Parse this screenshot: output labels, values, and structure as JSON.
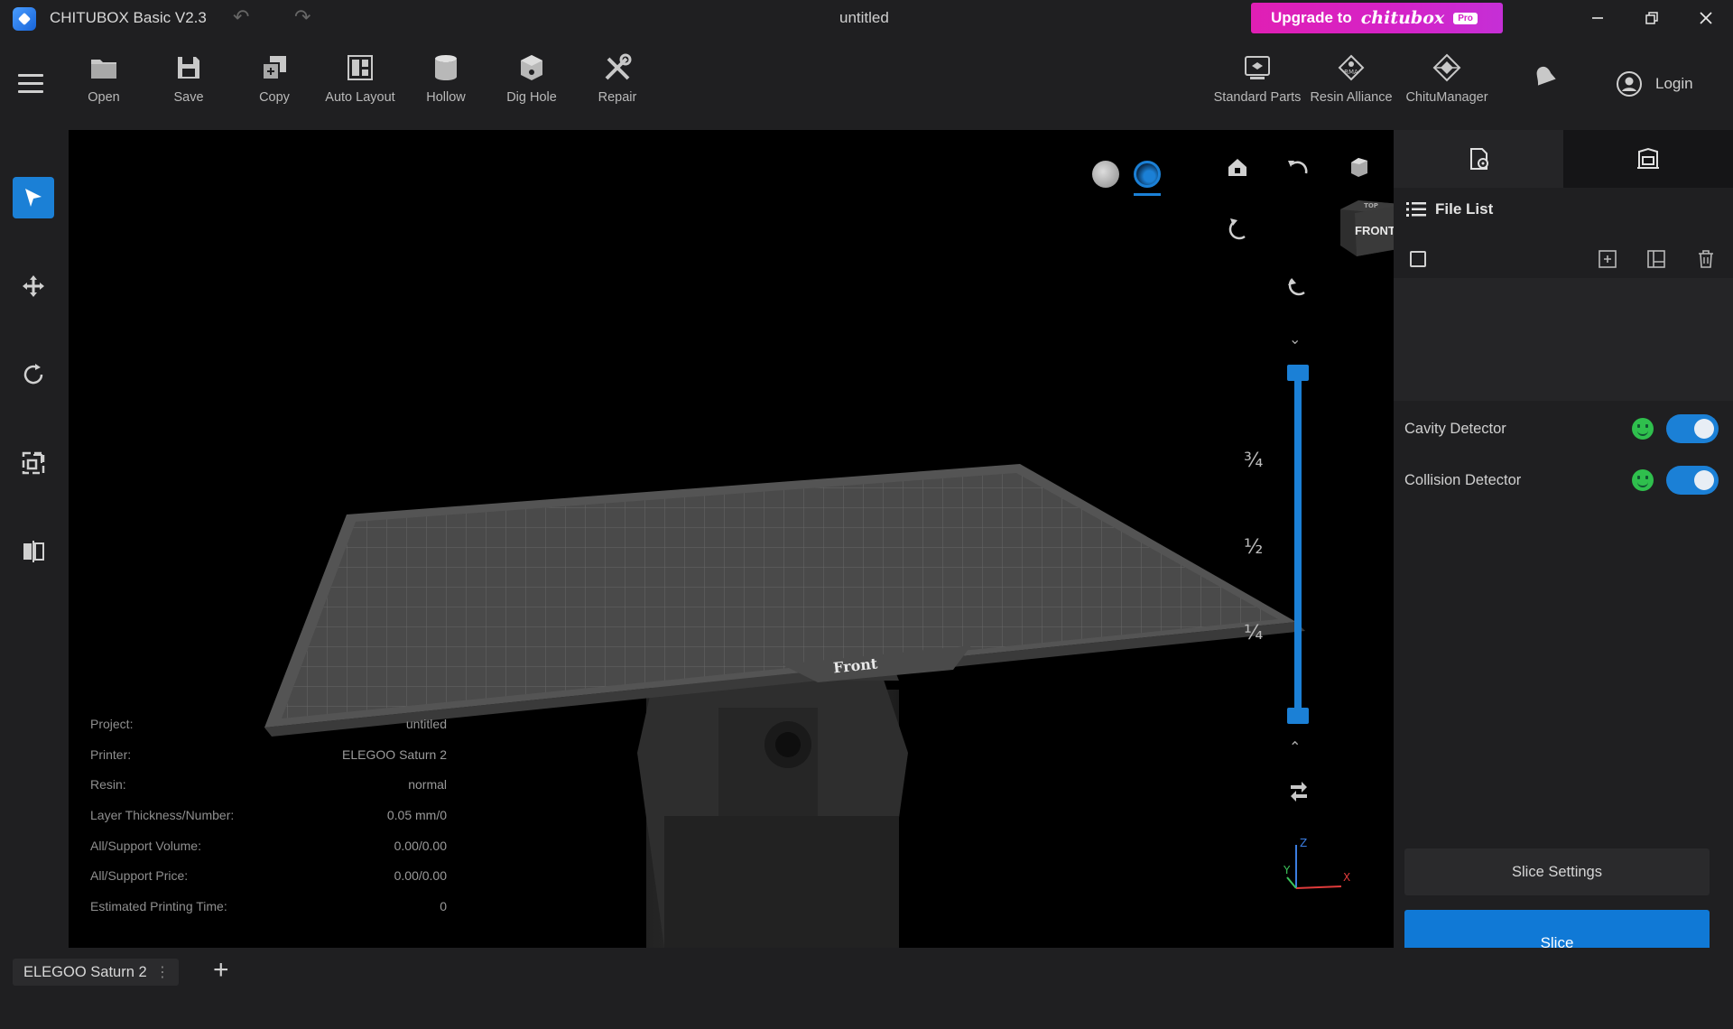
{
  "titlebar": {
    "app_title": "CHITUBOX Basic V2.3",
    "document_title": "untitled",
    "upgrade_label": "Upgrade to",
    "upgrade_brand": "chitubox",
    "upgrade_badge": "Pro"
  },
  "toolbar": {
    "tools": [
      {
        "label": "Open",
        "icon": "folder-icon"
      },
      {
        "label": "Save",
        "icon": "save-icon"
      },
      {
        "label": "Copy",
        "icon": "copy-icon"
      },
      {
        "label": "Auto Layout",
        "icon": "auto-layout-icon"
      },
      {
        "label": "Hollow",
        "icon": "hollow-icon"
      },
      {
        "label": "Dig Hole",
        "icon": "dig-hole-icon"
      },
      {
        "label": "Repair",
        "icon": "repair-icon"
      }
    ],
    "right_tools": [
      {
        "label": "Standard Parts",
        "icon": "standard-parts-icon"
      },
      {
        "label": "Resin Alliance",
        "icon": "resin-alliance-icon"
      },
      {
        "label": "ChituManager",
        "icon": "chitumanager-icon"
      }
    ],
    "login_label": "Login"
  },
  "viewport": {
    "plate_label": "Front",
    "view_cube_label": "FRONT",
    "view_cube_top_label": "TOP",
    "z_fractions": [
      "¾",
      "½",
      "¼"
    ],
    "axis_labels": {
      "z": "Z",
      "y": "Y",
      "x": "X"
    },
    "info": [
      {
        "label": "Project:",
        "value": "untitled"
      },
      {
        "label": "Printer:",
        "value": "ELEGOO Saturn 2"
      },
      {
        "label": "Resin:",
        "value": "normal"
      },
      {
        "label": "Layer Thickness/Number:",
        "value": "0.05 mm/0"
      },
      {
        "label": "All/Support Volume:",
        "value": "0.00/0.00"
      },
      {
        "label": "All/Support Price:",
        "value": "0.00/0.00"
      },
      {
        "label": "Estimated Printing Time:",
        "value": "0"
      }
    ]
  },
  "right_panel": {
    "file_list_title": "File List",
    "cavity_detector": "Cavity Detector",
    "collision_detector": "Collision Detector",
    "slice_settings_label": "Slice Settings",
    "slice_label": "Slice"
  },
  "bottom": {
    "printer_tab": "ELEGOO Saturn 2",
    "add_tab": "+"
  },
  "colors": {
    "accent": "#1b80d6",
    "upgrade_gradient_start": "#e01fb4",
    "detector_ok": "#2fbf4d"
  }
}
